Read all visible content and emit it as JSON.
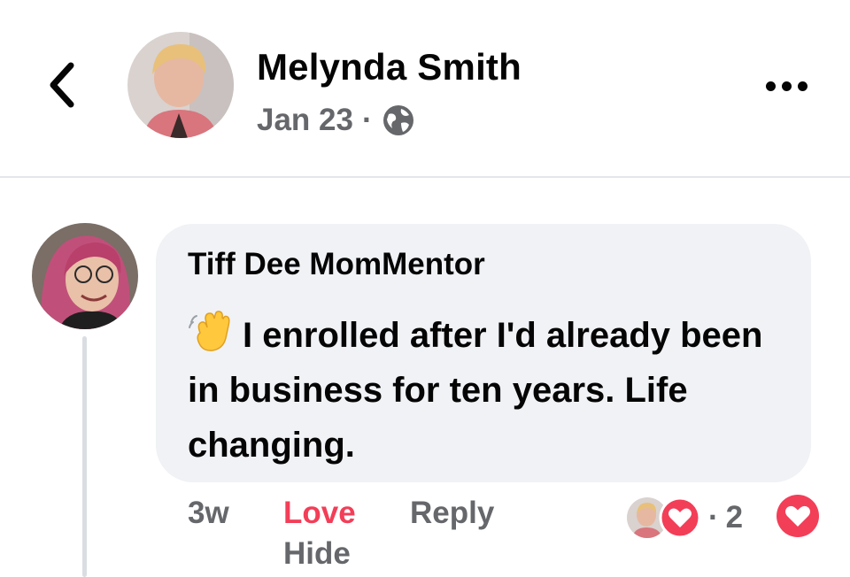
{
  "post": {
    "author_name": "Melynda Smith",
    "date": "Jan 23",
    "separator": "·",
    "privacy_icon": "globe-icon"
  },
  "header": {
    "back_icon": "chevron-left-icon",
    "more_icon": "more-dots-icon"
  },
  "comment": {
    "author_name": "Tiff Dee MomMentor",
    "emoji": "waving-hand",
    "text": "I enrolled after I'd already been in business for ten years. Life changing.",
    "time": "3w",
    "love_label": "Love",
    "reply_label": "Reply",
    "hide_label": "Hide",
    "reaction_separator": "·",
    "reaction_count": "2",
    "reaction_icon": "heart-reaction-icon"
  },
  "colors": {
    "love_red": "#f33e58",
    "muted_text": "#65676b",
    "bubble_bg": "#f0f2f5"
  }
}
